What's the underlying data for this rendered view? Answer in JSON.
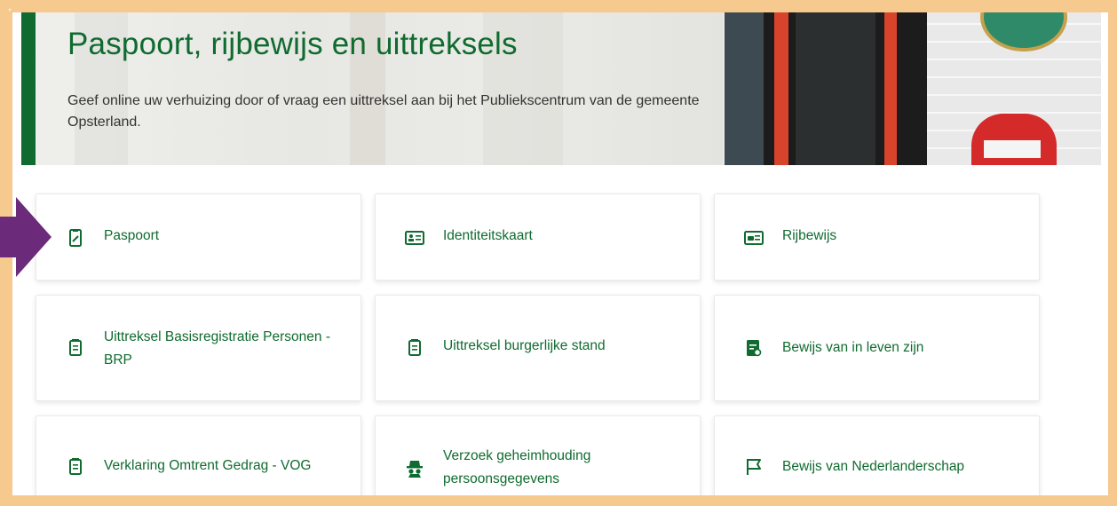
{
  "hero": {
    "title": "Paspoort, rijbewijs en uittreksels",
    "intro": "Geef online uw verhuizing door of vraag een uittreksel aan bij het Publiekscentrum van de gemeente Opsterland."
  },
  "services": [
    {
      "label": "Paspoort",
      "icon": "passport-icon"
    },
    {
      "label": "Identiteitskaart",
      "icon": "id-card-icon"
    },
    {
      "label": "Rijbewijs",
      "icon": "drivers-license-icon"
    },
    {
      "label": "Uittreksel Basisregistratie Personen - BRP",
      "icon": "document-icon"
    },
    {
      "label": "Uittreksel burgerlijke stand",
      "icon": "document-icon"
    },
    {
      "label": "Bewijs van in leven zijn",
      "icon": "certificate-icon"
    },
    {
      "label": "Verklaring Omtrent Gedrag - VOG",
      "icon": "document-icon"
    },
    {
      "label": "Verzoek geheimhouding persoonsgegevens",
      "icon": "incognito-icon"
    },
    {
      "label": "Bewijs van Nederlanderschap",
      "icon": "flag-icon"
    }
  ],
  "colors": {
    "brand_green": "#0f6b2f",
    "highlight_frame": "#f6c98f",
    "annotation_arrow": "#6b2a7a"
  }
}
